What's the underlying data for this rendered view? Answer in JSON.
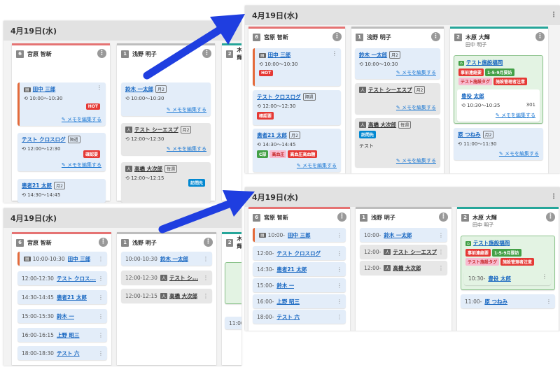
{
  "date": "4月19日(水)",
  "kebab": "⋮",
  "columns": {
    "c1": {
      "num": "6",
      "name": "宮原 智新"
    },
    "c2": {
      "num": "1",
      "name": "浅野 明子"
    },
    "c3": {
      "num": "2",
      "name": "木原 大輝",
      "sub": "田中 明子"
    }
  },
  "memo_label": "メモを編集する",
  "tags": {
    "hot": "HOT",
    "kakunin": "確認要",
    "c": "C部",
    "kou": "高血圧",
    "kaigo": "高血圧高血糖",
    "hou": "訪問先",
    "ren": "事前連絡要",
    "kyu": "1-5-9月要訪",
    "tagname": "テスト施設タグ",
    "shi": "施設管理者注意"
  },
  "cards": {
    "tanaka": {
      "name": "田中 三郎",
      "time": "10:00〜10:30"
    },
    "test_cross": {
      "name": "テスト クロスログ",
      "badge": "隔週",
      "time": "12:00〜12:30"
    },
    "kanja": {
      "name": "患者21 太郎",
      "badge": "月2",
      "time": "14:30〜14:45"
    },
    "suzuki": {
      "name": "鈴木 一太郎",
      "badge": "月2",
      "time": "10:00〜10:30"
    },
    "test_sies": {
      "name": "テスト シーエスプ",
      "badge": "月2",
      "time": "12:00〜12:30"
    },
    "takahashi": {
      "name": "高橋 大次郎",
      "badge": "毎週",
      "time": "12:00〜12:15",
      "note": "テスト"
    },
    "facility": {
      "name": "テスト施設福岡"
    },
    "yakuin": {
      "name": "豊役 太郎",
      "time": "10:30〜10:35",
      "room": "301"
    },
    "hara": {
      "name": "原 つねみ",
      "badge": "月2",
      "time": "11:00〜11:30"
    }
  },
  "compact_left": {
    "c1": [
      {
        "time": "10:00-10:30",
        "name": "田中 三郎"
      },
      {
        "time": "12:00-12:30",
        "name": "テスト クロス..."
      },
      {
        "time": "14:30-14:45",
        "name": "患者21 太郎"
      },
      {
        "time": "15:00-15:30",
        "name": "鈴木 一"
      },
      {
        "time": "16:00-16:15",
        "name": "上野 昭三"
      },
      {
        "time": "18:00-18:30",
        "name": "テスト 六"
      }
    ],
    "c2": [
      {
        "time": "10:00-10:30",
        "name": "鈴木 一太郎"
      },
      {
        "time": "12:00-12:30",
        "name": "テスト シ..."
      },
      {
        "time": "12:00-12:15",
        "name": "高橋 大次郎"
      }
    ],
    "c3_peek": "11:00"
  },
  "compact_right": {
    "c1": [
      {
        "time": "10:00-",
        "name": "田中 三郎"
      },
      {
        "time": "12:00-",
        "name": "テスト クロスログ"
      },
      {
        "time": "14:30-",
        "name": "患者21 太郎"
      },
      {
        "time": "15:00-",
        "name": "鈴木 一"
      },
      {
        "time": "16:00-",
        "name": "上野 昭三"
      },
      {
        "time": "18:00-",
        "name": "テスト 六"
      }
    ],
    "c2": [
      {
        "time": "10:00-",
        "name": "鈴木 一太郎"
      },
      {
        "time": "12:00-",
        "name": "テスト シーエスプ"
      },
      {
        "time": "12:00-",
        "name": "高橋 大次郎"
      }
    ],
    "c3": [
      {
        "time": "10:30-",
        "name": "豊役 太郎"
      },
      {
        "time": "11:00-",
        "name": "原 つねみ"
      }
    ]
  },
  "colors": {
    "arrow": "#1f3ee0",
    "accent_red": "#e57373",
    "accent_teal": "#26a69a"
  }
}
